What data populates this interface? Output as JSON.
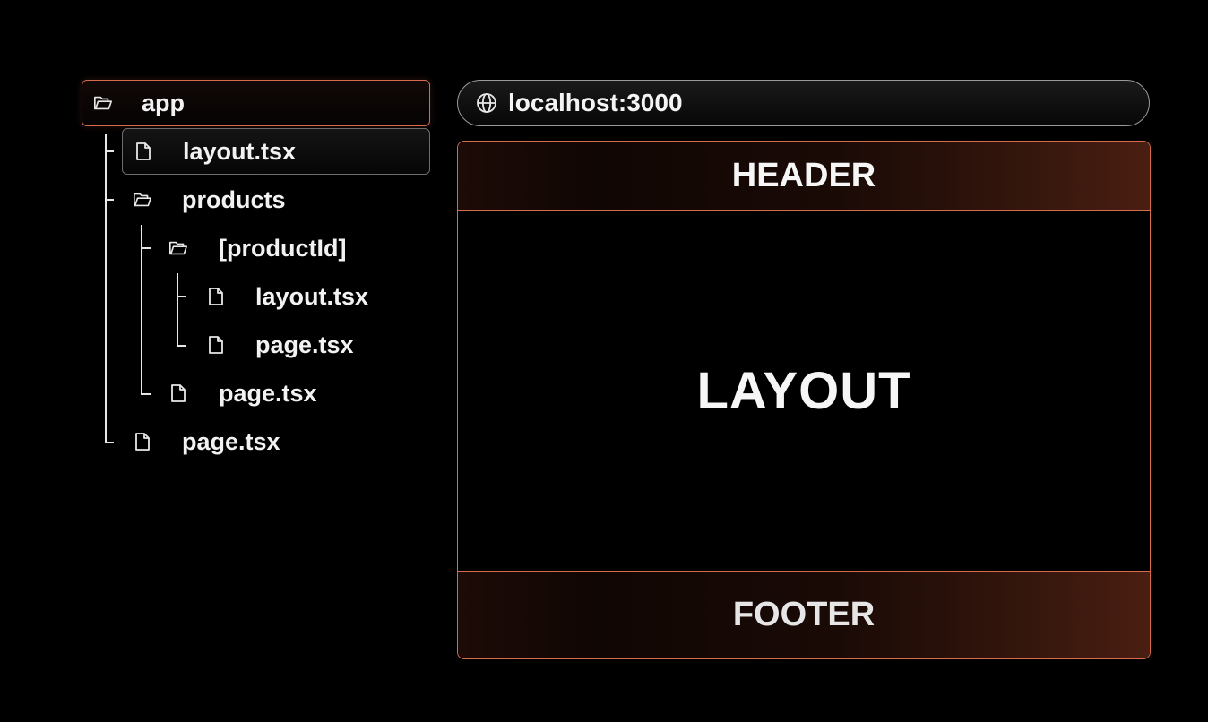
{
  "tree": {
    "items": [
      {
        "label": "app",
        "icon": "folder-open-icon"
      },
      {
        "label": "layout.tsx",
        "icon": "file-icon"
      },
      {
        "label": "products",
        "icon": "folder-open-icon"
      },
      {
        "label": "[productId]",
        "icon": "folder-open-icon"
      },
      {
        "label": "layout.tsx",
        "icon": "file-icon"
      },
      {
        "label": "page.tsx",
        "icon": "file-icon"
      },
      {
        "label": "page.tsx",
        "icon": "file-icon"
      },
      {
        "label": "page.tsx",
        "icon": "file-icon"
      }
    ]
  },
  "browser": {
    "url": "localhost:3000",
    "url_icon": "globe-icon",
    "header": "HEADER",
    "body": "LAYOUT",
    "footer": "FOOTER"
  },
  "colors": {
    "background": "#000000",
    "accent": "#d86a4e",
    "text": "#f4f4f4"
  }
}
